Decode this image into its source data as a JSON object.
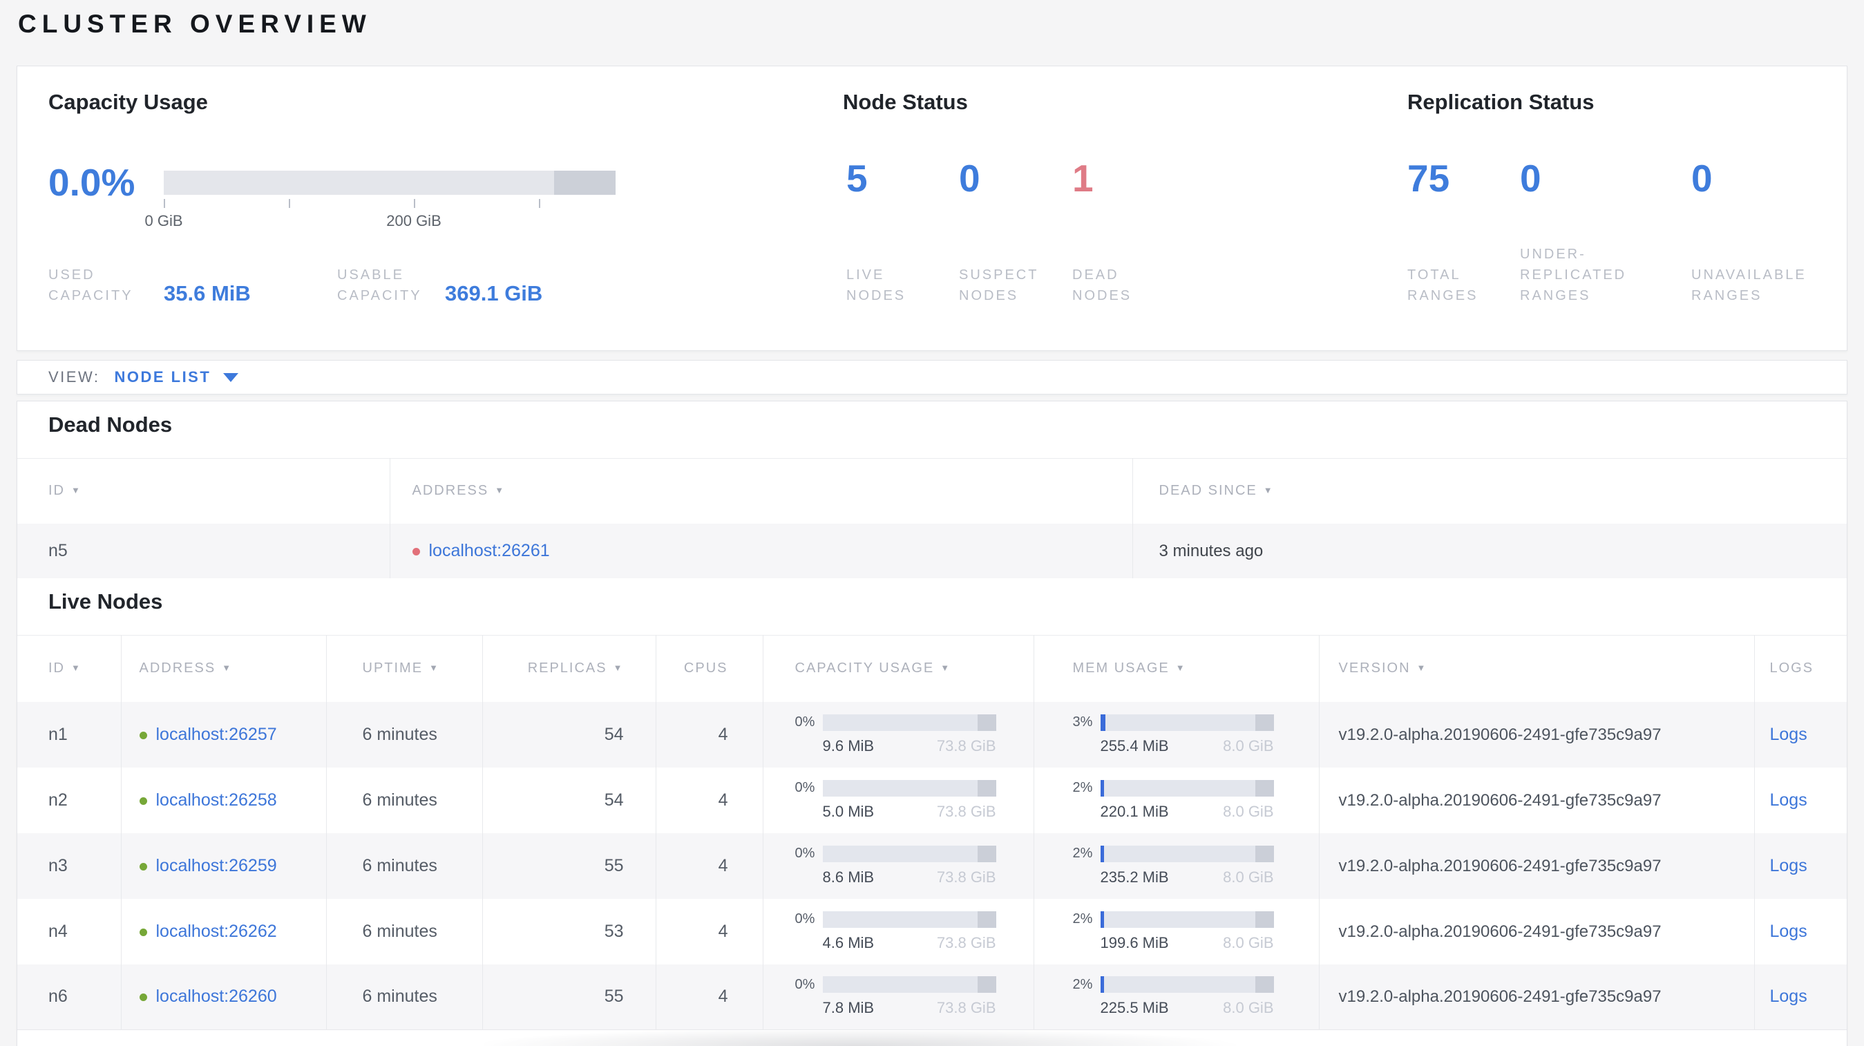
{
  "page_title": "CLUSTER OVERVIEW",
  "colors": {
    "accent_blue": "#3e7cdc",
    "link_blue": "#3d76d9",
    "danger_rose": "#df7b86",
    "live_dot_green": "#76a737",
    "dead_dot_red": "#e2707a",
    "bar_fill_blue": "#3a6bd9"
  },
  "summary": {
    "capacity": {
      "title": "Capacity Usage",
      "percent": "0.0%",
      "tick_labels": [
        "0 GiB",
        "200 GiB"
      ],
      "used_label": "USED\nCAPACITY",
      "used_value": "35.6 MiB",
      "usable_label": "USABLE\nCAPACITY",
      "usable_value": "369.1 GiB"
    },
    "node_status": {
      "title": "Node Status",
      "live": {
        "value": "5",
        "label": "LIVE\nNODES"
      },
      "suspect": {
        "value": "0",
        "label": "SUSPECT\nNODES"
      },
      "dead": {
        "value": "1",
        "label": "DEAD\nNODES"
      }
    },
    "replication": {
      "title": "Replication Status",
      "total": {
        "value": "75",
        "label": "TOTAL\nRANGES"
      },
      "under_replicated": {
        "value": "0",
        "label": "UNDER-\nREPLICATED\nRANGES"
      },
      "unavailable": {
        "value": "0",
        "label": "UNAVAILABLE\nRANGES"
      }
    }
  },
  "view_bar": {
    "label": "VIEW:",
    "selected": "NODE LIST"
  },
  "dead_nodes": {
    "title": "Dead Nodes",
    "columns": {
      "id": "ID",
      "address": "ADDRESS",
      "dead_since": "DEAD SINCE"
    },
    "rows": [
      {
        "id": "n5",
        "address": "localhost:26261",
        "dead_since": "3 minutes ago"
      }
    ]
  },
  "live_nodes": {
    "title": "Live Nodes",
    "columns": {
      "id": "ID",
      "address": "ADDRESS",
      "uptime": "UPTIME",
      "replicas": "REPLICAS",
      "cpus": "CPUS",
      "capacity": "CAPACITY USAGE",
      "mem": "MEM USAGE",
      "version": "VERSION",
      "logs": "LOGS"
    },
    "rows": [
      {
        "id": "n1",
        "address": "localhost:26257",
        "uptime": "6 minutes",
        "replicas": "54",
        "cpus": "4",
        "capacity_pct": "0%",
        "capacity_fill": 0,
        "capacity_used": "9.6 MiB",
        "capacity_total": "73.8 GiB",
        "mem_pct": "3%",
        "mem_fill": 3,
        "mem_used": "255.4 MiB",
        "mem_total": "8.0 GiB",
        "version": "v19.2.0-alpha.20190606-2491-gfe735c9a97",
        "logs": "Logs"
      },
      {
        "id": "n2",
        "address": "localhost:26258",
        "uptime": "6 minutes",
        "replicas": "54",
        "cpus": "4",
        "capacity_pct": "0%",
        "capacity_fill": 0,
        "capacity_used": "5.0 MiB",
        "capacity_total": "73.8 GiB",
        "mem_pct": "2%",
        "mem_fill": 2,
        "mem_used": "220.1 MiB",
        "mem_total": "8.0 GiB",
        "version": "v19.2.0-alpha.20190606-2491-gfe735c9a97",
        "logs": "Logs"
      },
      {
        "id": "n3",
        "address": "localhost:26259",
        "uptime": "6 minutes",
        "replicas": "55",
        "cpus": "4",
        "capacity_pct": "0%",
        "capacity_fill": 0,
        "capacity_used": "8.6 MiB",
        "capacity_total": "73.8 GiB",
        "mem_pct": "2%",
        "mem_fill": 2,
        "mem_used": "235.2 MiB",
        "mem_total": "8.0 GiB",
        "version": "v19.2.0-alpha.20190606-2491-gfe735c9a97",
        "logs": "Logs"
      },
      {
        "id": "n4",
        "address": "localhost:26262",
        "uptime": "6 minutes",
        "replicas": "53",
        "cpus": "4",
        "capacity_pct": "0%",
        "capacity_fill": 0,
        "capacity_used": "4.6 MiB",
        "capacity_total": "73.8 GiB",
        "mem_pct": "2%",
        "mem_fill": 2,
        "mem_used": "199.6 MiB",
        "mem_total": "8.0 GiB",
        "version": "v19.2.0-alpha.20190606-2491-gfe735c9a97",
        "logs": "Logs"
      },
      {
        "id": "n6",
        "address": "localhost:26260",
        "uptime": "6 minutes",
        "replicas": "55",
        "cpus": "4",
        "capacity_pct": "0%",
        "capacity_fill": 0,
        "capacity_used": "7.8 MiB",
        "capacity_total": "73.8 GiB",
        "mem_pct": "2%",
        "mem_fill": 2,
        "mem_used": "225.5 MiB",
        "mem_total": "8.0 GiB",
        "version": "v19.2.0-alpha.20190606-2491-gfe735c9a97",
        "logs": "Logs"
      }
    ]
  }
}
